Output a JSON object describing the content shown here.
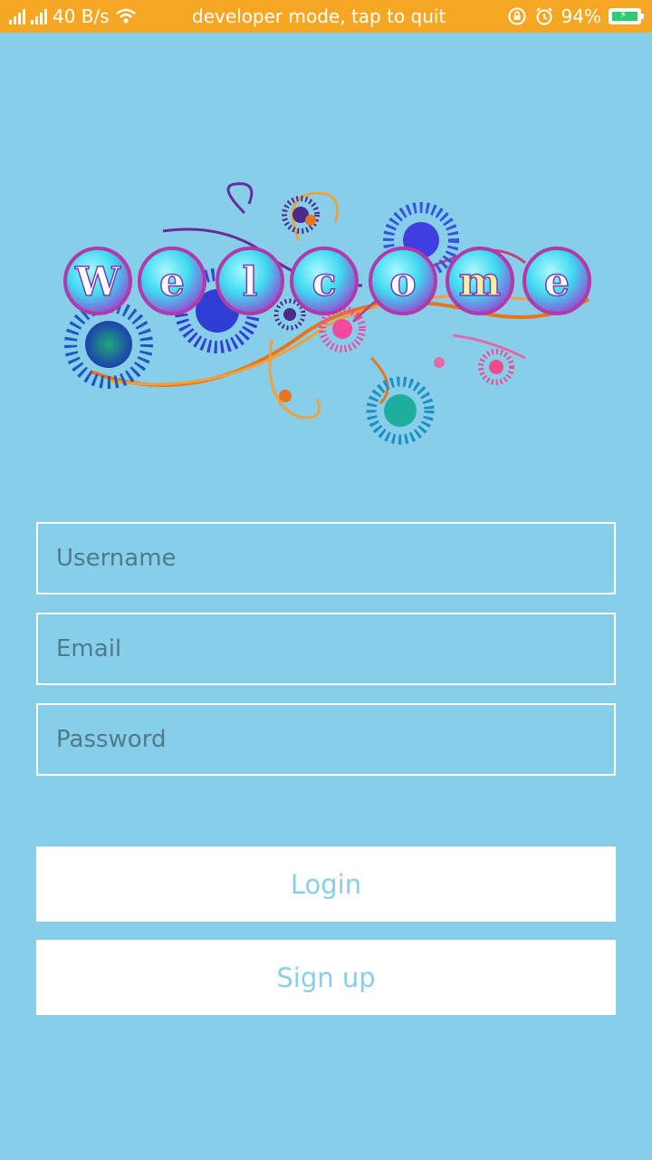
{
  "status_bar": {
    "speed": "40 B/s",
    "notification": "developer mode, tap to quit",
    "battery": "94%"
  },
  "logo": {
    "letters": [
      "W",
      "e",
      "l",
      "c",
      "o",
      "m",
      "e"
    ]
  },
  "form": {
    "username_placeholder": "Username",
    "email_placeholder": "Email",
    "password_placeholder": "Password",
    "login_label": "Login",
    "signup_label": "Sign up"
  },
  "colors": {
    "background": "#87CEEB",
    "status_bar": "#F5A623",
    "button_bg": "#FFFFFF",
    "button_text": "#87CEEB"
  }
}
